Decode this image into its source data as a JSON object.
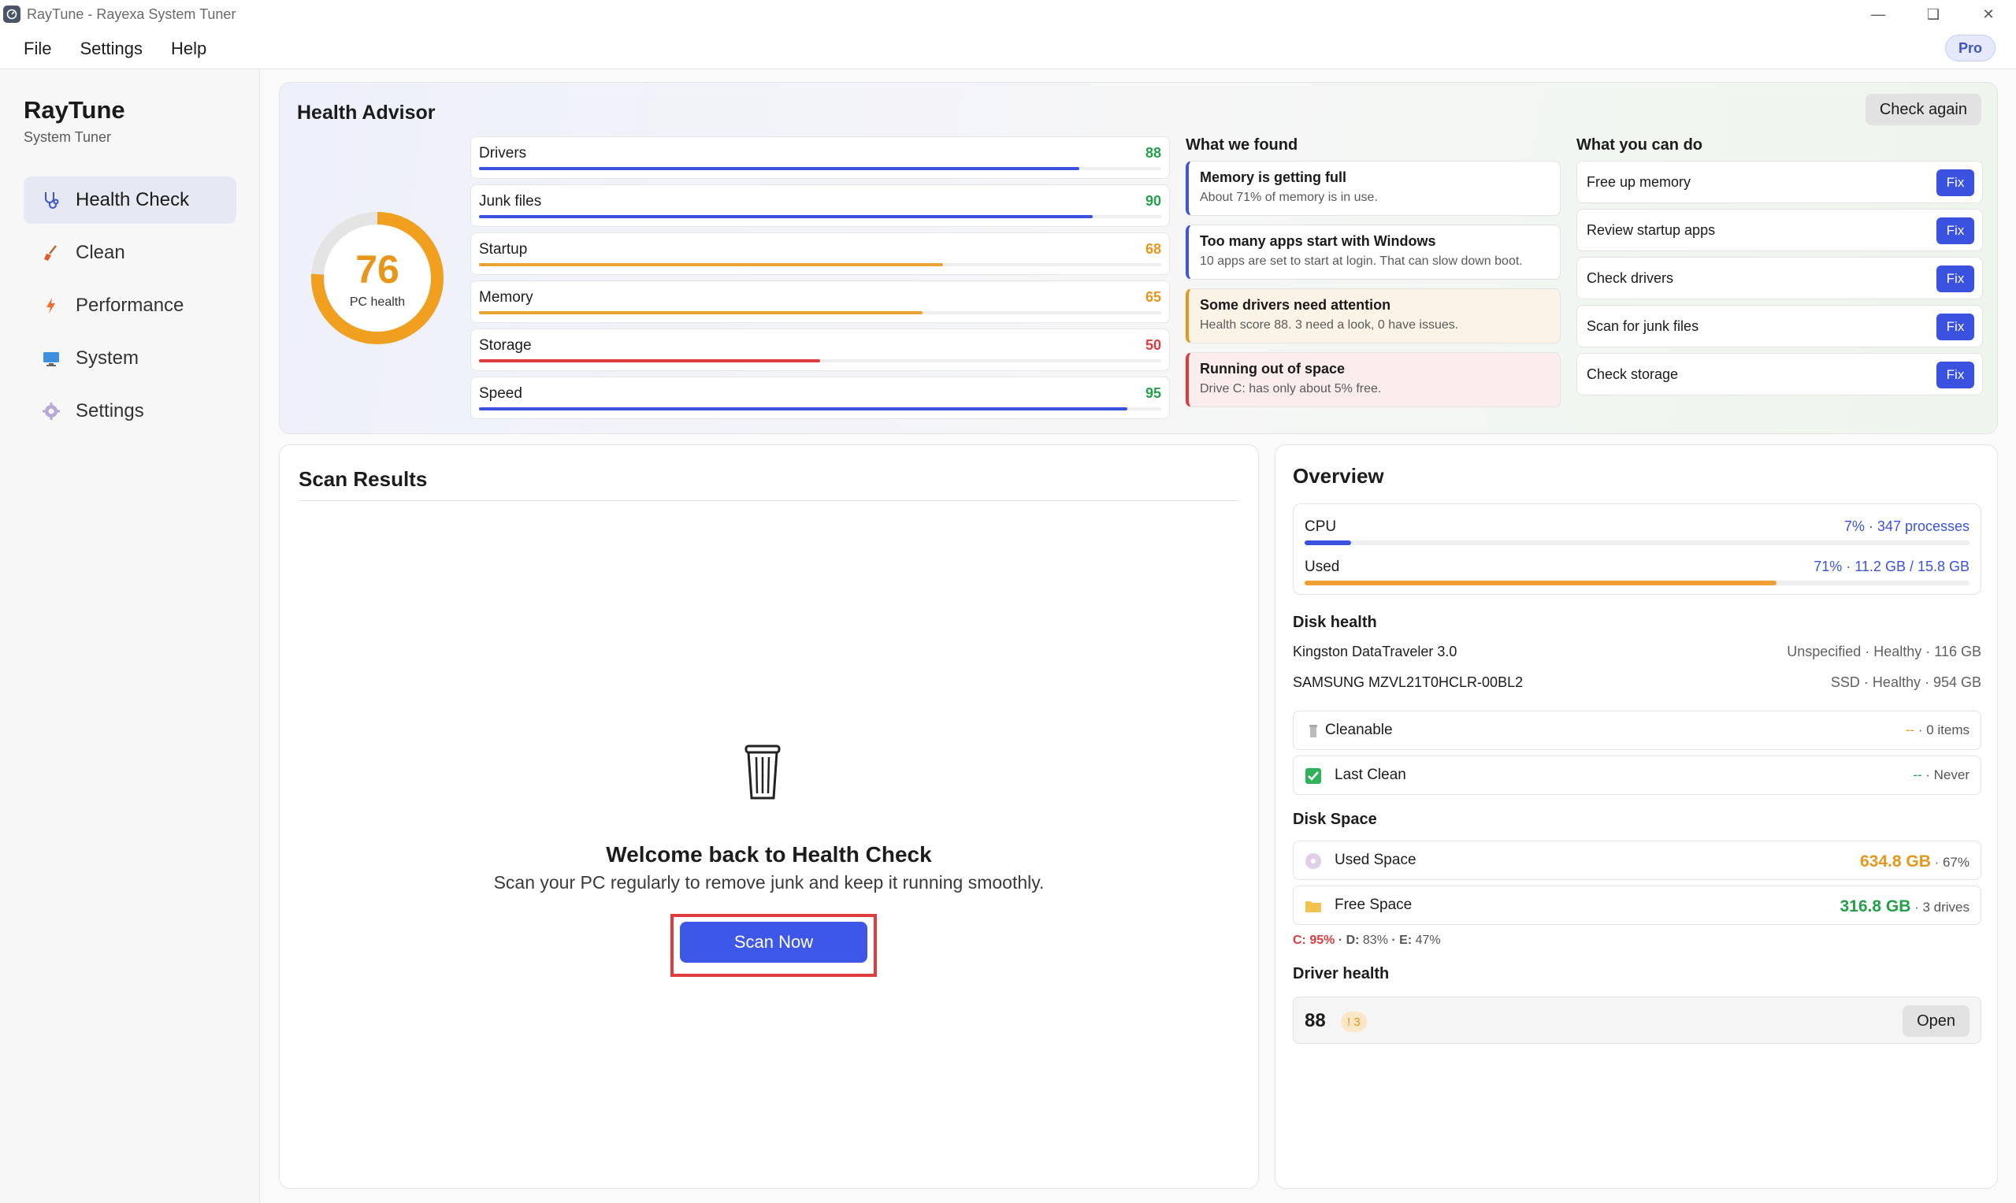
{
  "window": {
    "title": "RayTune - Rayexa System Tuner"
  },
  "menu": {
    "file": "File",
    "settings": "Settings",
    "help": "Help",
    "pro": "Pro"
  },
  "sidebar": {
    "brand": "RayTune",
    "subtitle": "System Tuner",
    "items": [
      {
        "label": "Health Check",
        "icon": "stethoscope-icon"
      },
      {
        "label": "Clean",
        "icon": "broom-icon"
      },
      {
        "label": "Performance",
        "icon": "bolt-icon"
      },
      {
        "label": "System",
        "icon": "monitor-icon"
      },
      {
        "label": "Settings",
        "icon": "gear-icon"
      }
    ]
  },
  "advisor": {
    "title": "Health Advisor",
    "check_again": "Check again",
    "score": "76",
    "score_label": "PC health",
    "score_fraction": 0.76,
    "metrics": [
      {
        "label": "Drivers",
        "value": "88",
        "pct": 0.88,
        "color": "#3a52df",
        "val_color": "#22a04a"
      },
      {
        "label": "Junk files",
        "value": "90",
        "pct": 0.9,
        "color": "#3a52df",
        "val_color": "#22a04a"
      },
      {
        "label": "Startup",
        "value": "68",
        "pct": 0.68,
        "color": "#e8a232",
        "val_color": "#e8961a"
      },
      {
        "label": "Memory",
        "value": "65",
        "pct": 0.65,
        "color": "#e8a232",
        "val_color": "#e8961a"
      },
      {
        "label": "Storage",
        "value": "50",
        "pct": 0.5,
        "color": "#e03b3b",
        "val_color": "#e03b3b"
      },
      {
        "label": "Speed",
        "value": "95",
        "pct": 0.95,
        "color": "#3a52df",
        "val_color": "#22a04a"
      }
    ],
    "found_head": "What we found",
    "found": [
      {
        "title": "Memory is getting full",
        "desc": "About 71% of memory is in use."
      },
      {
        "title": "Too many apps start with Windows",
        "desc": "10 apps are set to start at login. That can slow down boot."
      },
      {
        "title": "Some drivers need attention",
        "desc": "Health score 88. 3 need a look, 0 have issues."
      },
      {
        "title": "Running out of space",
        "desc": "Drive C: has only about 5% free."
      }
    ],
    "do_head": "What you can do",
    "fix_label": "Fix",
    "actions": [
      "Free up memory",
      "Review startup apps",
      "Check drivers",
      "Scan for junk files",
      "Check storage"
    ]
  },
  "scan": {
    "title": "Scan Results",
    "welcome": "Welcome back to Health Check",
    "sub": "Scan your PC regularly to remove junk and keep it running smoothly.",
    "button": "Scan Now"
  },
  "overview": {
    "title": "Overview",
    "cpu_label": "CPU",
    "cpu_val": "7% · 347 processes",
    "cpu_pct": 0.07,
    "mem_label": "Used",
    "mem_val": "71% · 11.2 GB / 15.8 GB",
    "mem_pct": 0.71,
    "disk_head": "Disk health",
    "disks": [
      {
        "name": "Kingston DataTraveler 3.0",
        "meta": "Unspecified · Healthy · 116 GB"
      },
      {
        "name": "SAMSUNG MZVL21T0HCLR-00BL2",
        "meta": "SSD · Healthy · 954 GB"
      }
    ],
    "cleanable_label": "Cleanable",
    "cleanable_dash": "--",
    "cleanable_items": " · 0 items",
    "lastclean_label": "Last Clean",
    "lastclean_dash": "--",
    "lastclean_val": " · Never",
    "space_head": "Disk Space",
    "used_label": "Used Space",
    "used_val": "634.8 GB",
    "used_pct": " · 67%",
    "free_label": "Free Space",
    "free_val": "316.8 GB",
    "free_drives": " · 3 drives",
    "drive_c": "C: 95%",
    "drive_rest_d": " · D: ",
    "drive_d": "83%",
    "drive_rest_e": " · E: ",
    "drive_e": "47%",
    "drv_head": "Driver health",
    "drv_score": "88",
    "drv_badge": "! 3",
    "open": "Open"
  }
}
